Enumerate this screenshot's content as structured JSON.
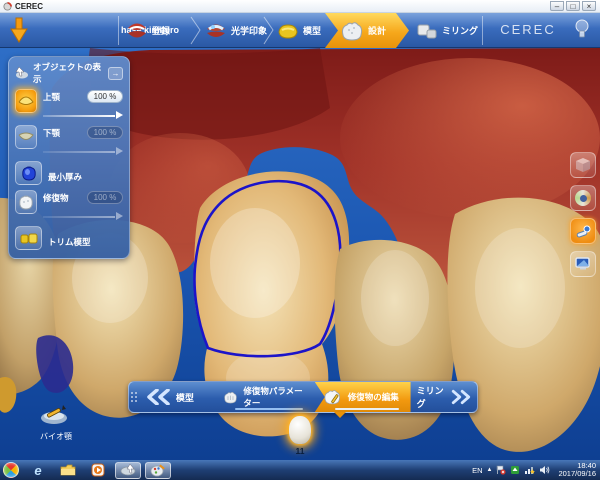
{
  "window": {
    "title": "CEREC",
    "controls": {
      "minimize": "–",
      "restore": "□",
      "close": "×"
    }
  },
  "top_nav": {
    "patient_name": "hase kimihiro",
    "steps": [
      {
        "label": "登録",
        "icon": "registration-jaw-icon",
        "active": false
      },
      {
        "label": "光学印象",
        "icon": "optical-impression-icon",
        "active": false
      },
      {
        "label": "模型",
        "icon": "model-icon",
        "active": false
      },
      {
        "label": "設計",
        "icon": "design-crown-icon",
        "active": true
      },
      {
        "label": "ミリング",
        "icon": "milling-icon",
        "active": false
      }
    ],
    "brand": "CEREC",
    "help_icon": "lightbulb-icon"
  },
  "object_panel": {
    "title": "オブジェクトの表示",
    "collapse_glyph": "→",
    "items": [
      {
        "label": "上顎",
        "value": "100 %",
        "enabled": true,
        "icon": "upper-jaw-icon"
      },
      {
        "label": "下顎",
        "value": "100 %",
        "enabled": false,
        "icon": "lower-jaw-icon"
      },
      {
        "label": "最小厚み",
        "value": "",
        "enabled": true,
        "icon": "minimum-thickness-icon"
      },
      {
        "label": "修復物",
        "value": "100 %",
        "enabled": false,
        "icon": "restoration-icon"
      },
      {
        "label": "トリム模型",
        "value": "",
        "enabled": true,
        "icon": "trim-model-icon"
      }
    ]
  },
  "right_toolbar": {
    "icons": [
      "view-cube-icon",
      "color-ring-icon",
      "analysis-tool-icon",
      "display-view-icon"
    ]
  },
  "bottom_nav": {
    "prev_label": "模型",
    "param_label": "修復物パラメーター",
    "edit_label": "修復物の編集",
    "next_label": "ミリング"
  },
  "bio_jaw": {
    "label": "バイオ顎"
  },
  "tooth_indicator": {
    "number": "11"
  },
  "taskbar": {
    "tray": {
      "language": "EN",
      "expand_glyph": "▲",
      "time": "18:40",
      "date": "2017/09/16"
    }
  },
  "colors": {
    "accent_orange": "#f6a81c",
    "nav_blue": "#3a6cbd",
    "gum_red": "#9c2a23",
    "tooth_gold": "#cfa86a",
    "margin_blue": "#1c14c9"
  }
}
